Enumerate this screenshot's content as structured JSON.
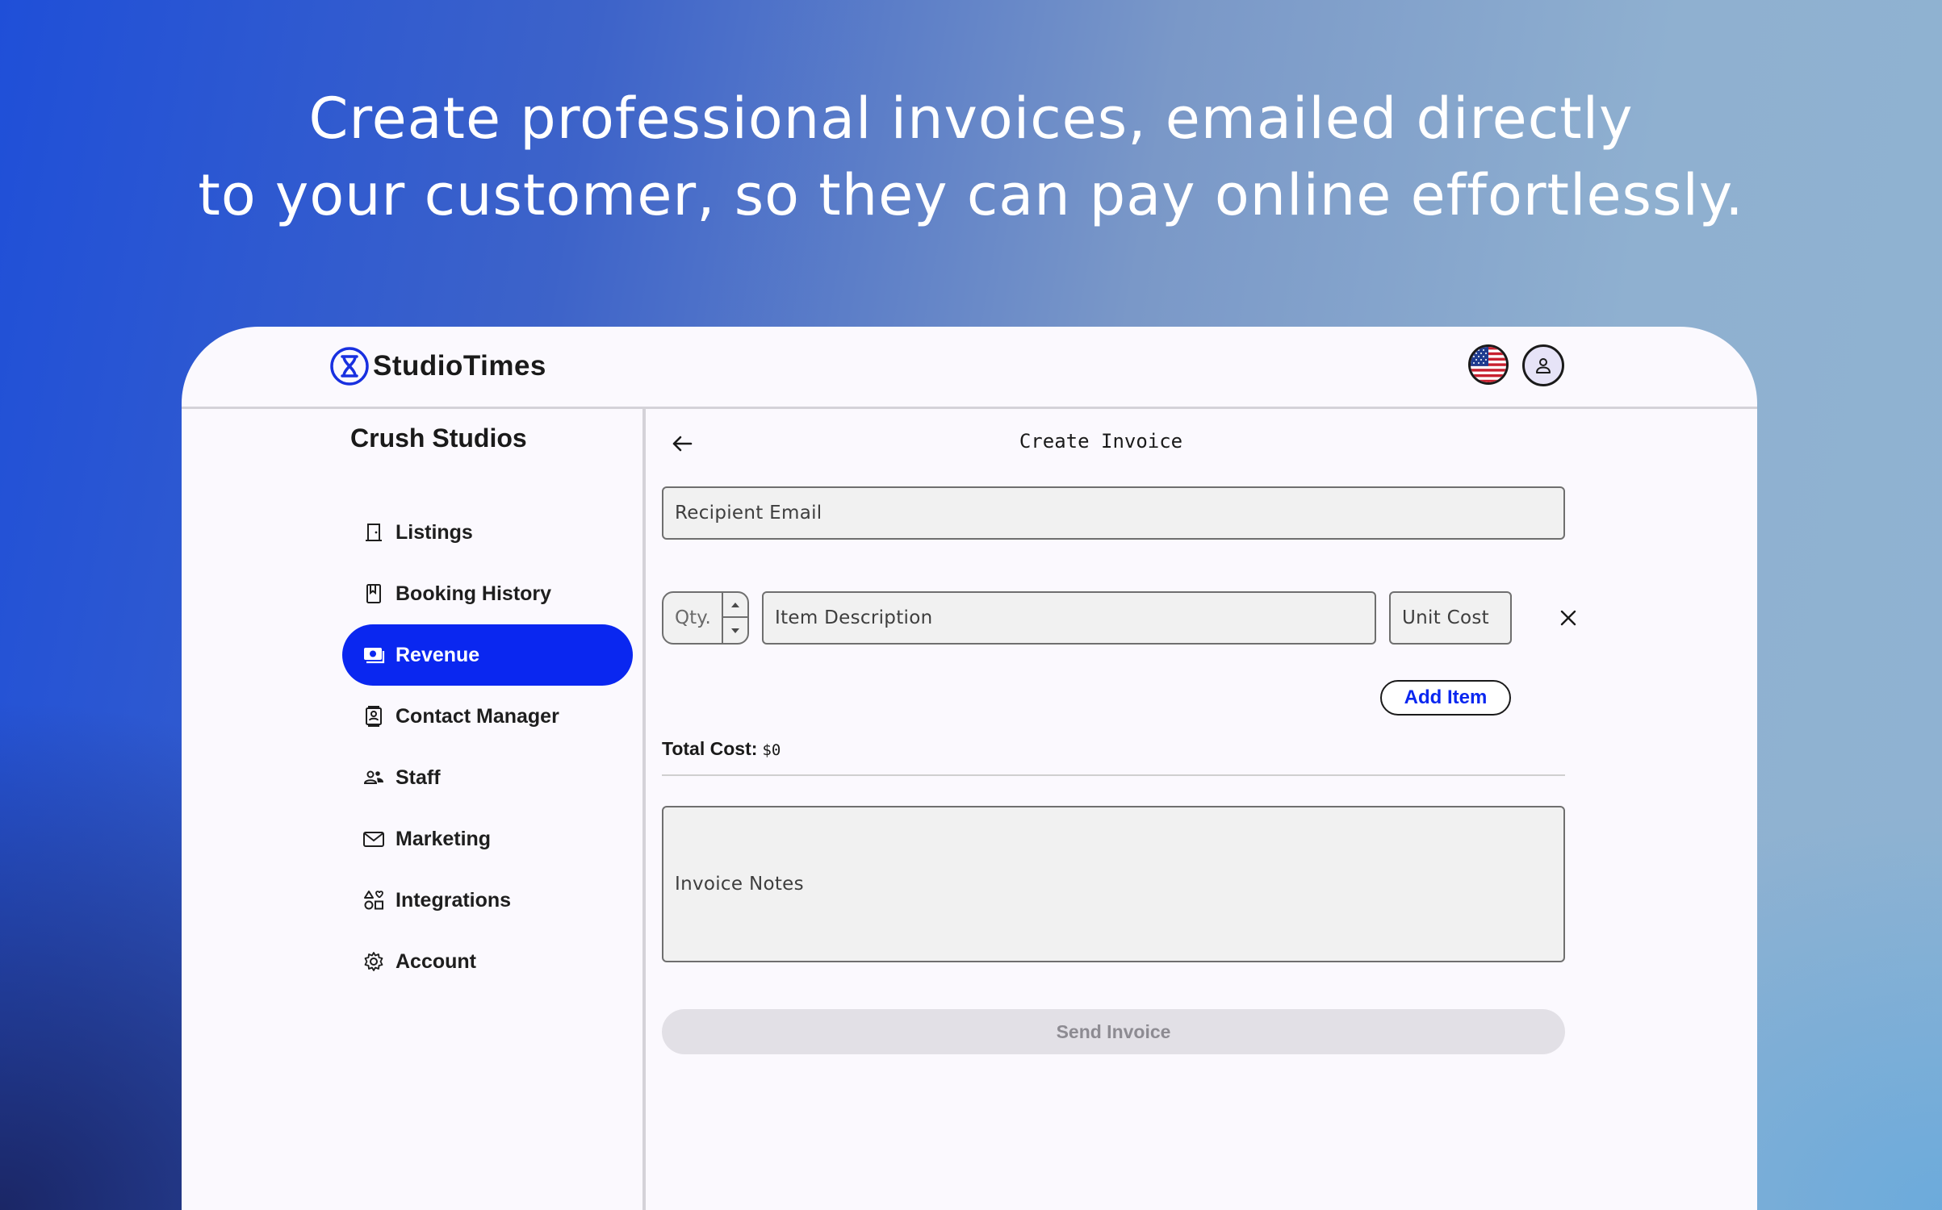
{
  "headline": {
    "line1": "Create professional invoices, emailed directly",
    "line2": "to your customer, so they can pay online effortlessly."
  },
  "header": {
    "brand": "StudioTimes",
    "flag_icon": "us-flag-icon",
    "user_icon": "user-icon"
  },
  "sidebar": {
    "studio_name": "Crush Studios",
    "items": [
      {
        "label": "Listings",
        "icon": "door-icon",
        "active": false
      },
      {
        "label": "Booking History",
        "icon": "book-icon",
        "active": false
      },
      {
        "label": "Revenue",
        "icon": "money-icon",
        "active": true
      },
      {
        "label": "Contact Manager",
        "icon": "contact-icon",
        "active": false
      },
      {
        "label": "Staff",
        "icon": "people-icon",
        "active": false
      },
      {
        "label": "Marketing",
        "icon": "mail-icon",
        "active": false
      },
      {
        "label": "Integrations",
        "icon": "shapes-icon",
        "active": false
      },
      {
        "label": "Account",
        "icon": "gear-icon",
        "active": false
      }
    ]
  },
  "main": {
    "title": "Create Invoice",
    "recipient_placeholder": "Recipient Email",
    "qty_placeholder": "Qty.",
    "item_description_placeholder": "Item Description",
    "unit_cost_placeholder": "Unit Cost",
    "add_item_label": "Add Item",
    "total_label": "Total Cost:",
    "total_value": "$0",
    "notes_placeholder": "Invoice Notes",
    "send_label": "Send Invoice"
  },
  "colors": {
    "accent": "#0a27f0",
    "active_text": "#ffffff",
    "disabled_button": "#e2e0e6"
  }
}
